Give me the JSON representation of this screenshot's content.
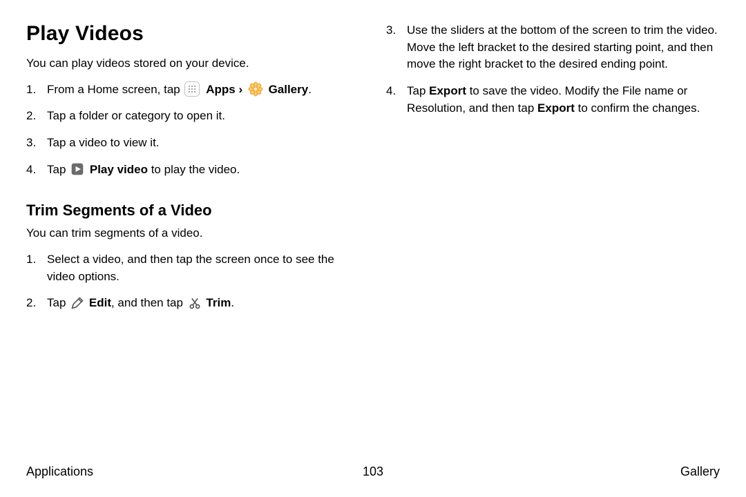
{
  "left": {
    "heading": "Play Videos",
    "intro": "You can play videos stored on your device.",
    "steps": {
      "s1_a": "From a Home screen, tap ",
      "s1_apps": "Apps",
      "s1_sep": " › ",
      "s1_gallery": "Gallery",
      "s1_end": ".",
      "s2": "Tap a folder or category to open it.",
      "s3": "Tap a video to view it.",
      "s4_a": "Tap ",
      "s4_b": "Play video",
      "s4_c": " to play the video."
    },
    "sub_heading": "Trim Segments of a Video",
    "sub_intro": "You can trim segments of a video.",
    "trim": {
      "t1": "Select a video, and then tap the screen once to see the video options.",
      "t2_a": "Tap ",
      "t2_edit": "Edit",
      "t2_b": ", and then tap ",
      "t2_trim": "Trim",
      "t2_c": "."
    }
  },
  "right": {
    "s3": "Use the sliders at the bottom of the screen to trim the video. Move the left bracket to the desired starting point, and then move the right bracket to the desired ending point.",
    "s4_a": "Tap ",
    "s4_export1": "Export",
    "s4_b": " to save the video. Modify the File name or Resolution, and then tap ",
    "s4_export2": "Export",
    "s4_c": " to confirm the changes."
  },
  "footer": {
    "left": "Applications",
    "page": "103",
    "right": "Gallery"
  }
}
